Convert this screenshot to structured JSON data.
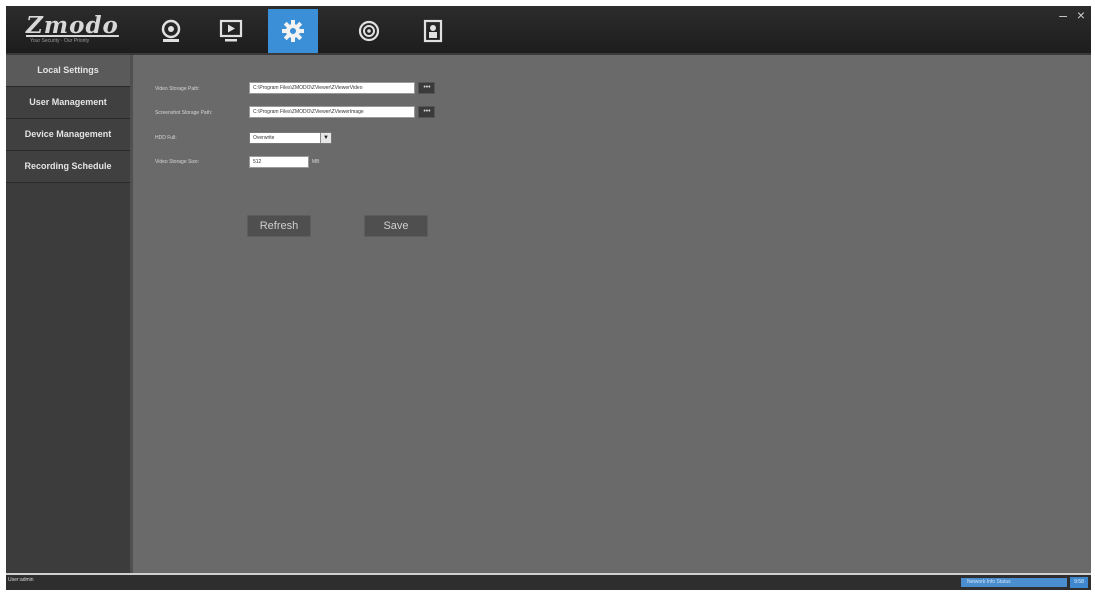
{
  "app": {
    "logo_text": "Zmodo",
    "logo_tagline": "Your Security · Our Priority",
    "window_controls": {
      "minimize": "–",
      "close": "×"
    }
  },
  "toolbar": {
    "tabs": [
      {
        "icon": "camera-icon",
        "active": false
      },
      {
        "icon": "playback-icon",
        "active": false
      },
      {
        "icon": "gear-icon",
        "active": true
      },
      {
        "icon": "cloud-sync-icon",
        "active": false
      },
      {
        "icon": "user-logout-icon",
        "active": false
      }
    ],
    "active_color": "#3a8fd6"
  },
  "sidebar": {
    "items": [
      {
        "label": "Local Settings",
        "active": true
      },
      {
        "label": "User Management",
        "active": false
      },
      {
        "label": "Device Management",
        "active": false
      },
      {
        "label": "Recording Schedule",
        "active": false
      }
    ]
  },
  "form": {
    "video_path": {
      "label": "Video Storage Path:",
      "value": "C:\\Program Files\\ZMODO\\ZViewer\\ZViewerVideo",
      "browse_label": "• • •"
    },
    "screenshot_path": {
      "label": "Screenshot Storage Path:",
      "value": "C:\\Program Files\\ZMODO\\ZViewer\\ZViewerImage",
      "browse_label": "• • •"
    },
    "hdd_full": {
      "label": "HDD Full:",
      "value": "Overwrite"
    },
    "video_size": {
      "label": "Video Storage Size:",
      "value": "512",
      "unit": "MB"
    },
    "refresh_label": "Refresh",
    "save_label": "Save"
  },
  "status": {
    "user": "User:admin",
    "network": "Network  Info  Status",
    "time": "9:58"
  }
}
